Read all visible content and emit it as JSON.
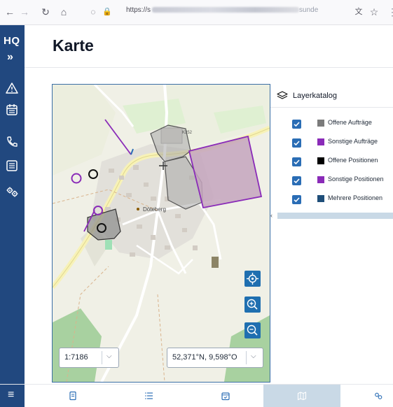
{
  "browser": {
    "url_prefix": "https://s",
    "url_tail": "sunde"
  },
  "sidebar": {
    "logo_text": "HQ",
    "expand_label": "»",
    "items": [
      {
        "icon": "warning-icon"
      },
      {
        "icon": "calendar-icon"
      },
      {
        "icon": "phone-icon"
      },
      {
        "icon": "checklist-icon"
      },
      {
        "icon": "settings-icon"
      }
    ]
  },
  "page": {
    "title": "Karte"
  },
  "map": {
    "place_label": "Döteberg",
    "road_label_1": "K252",
    "scale": "1:7186",
    "coordinates": "52,371°N, 9,598°O"
  },
  "layer_catalog": {
    "title": "Layerkatalog",
    "collapse_label": "‹",
    "layers": [
      {
        "label": "Offene Aufträge",
        "color": "#7b7b7b",
        "checked": true
      },
      {
        "label": "Sonstige Aufträge",
        "color": "#8a2bb8",
        "checked": true
      },
      {
        "label": "Offene Positionen",
        "color": "#000000",
        "checked": true
      },
      {
        "label": "Sonstige Positionen",
        "color": "#8a2bb8",
        "checked": true
      },
      {
        "label": "Mehrere Positionen",
        "color": "#1f4e79",
        "checked": true
      }
    ]
  },
  "bottom_nav": {
    "menu_label": "≡",
    "tabs": [
      {
        "icon": "document-icon"
      },
      {
        "icon": "list-icon"
      },
      {
        "icon": "calendar-check-icon"
      },
      {
        "icon": "map-icon",
        "active": true
      },
      {
        "icon": "settings-icon"
      }
    ]
  },
  "colors": {
    "brand": "#21487f",
    "accent": "#2a6db5",
    "active_tab": "#c9d9e6"
  }
}
